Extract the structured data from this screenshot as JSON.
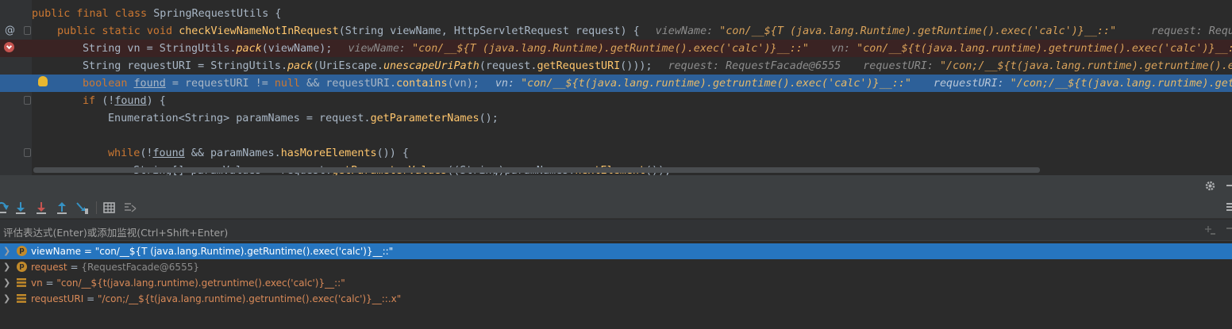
{
  "editor": {
    "lines": {
      "l1": {
        "kw": "public final class ",
        "cls": "SpringRequestUtils",
        "rest": " {"
      },
      "l2": {
        "kw": "public static void ",
        "fn": "checkViewNameNotInRequest",
        "p1": "(",
        "t1": "String",
        "a1": " viewName, ",
        "t2": "HttpServletRequest",
        "a2": " request) {",
        "h1n": "viewName: ",
        "h1v": "\"con/__${T (java.lang.Runtime).getRuntime().exec('calc')}__::\"",
        "h2n": "request: Request"
      },
      "l3": {
        "t": "String",
        "a": " vn = ",
        "c": "StringUtils",
        "d": ".",
        "m": "pack",
        "e": "(viewName);",
        "h1n": "viewName: ",
        "h1v": "\"con/__${T (java.lang.Runtime).getRuntime().exec('calc')}__::\"",
        "h2n": "vn: ",
        "h2v": "\"con/__${t(java.lang.runtime).getruntime().exec('calc')}__::"
      },
      "l4": {
        "t": "String",
        "a": " requestURI = ",
        "c": "StringUtils",
        "d": ".",
        "m": "pack",
        "p": "(",
        "c2": "UriEscape",
        "d2": ".",
        "m2": "unescapeUriPath",
        "p2": "(request.",
        "m3": "getRequestURI",
        "e": "()));",
        "h1n": "request: ",
        "h1v": "RequestFacade@6555",
        "h2n": "requestURI: ",
        "h2v": "\"/con;/__${t(java.lang.runtime).getruntime().ex"
      },
      "l5": {
        "kw": "boolean ",
        "v": "found",
        "a": " = requestURI != ",
        "kw2": "null",
        "b": " && requestURI.",
        "m": "contains",
        "e": "(vn);",
        "h1n": "vn: ",
        "h1v": "\"con/__${t(java.lang.runtime).getruntime().exec('calc')}__::\"",
        "h2n": "requestURI: ",
        "h2v": "\"/con;/__${t(java.lang.runtime).getr"
      },
      "l6": {
        "kw": "if ",
        "a": "(!",
        "v": "found",
        "e": ") {"
      },
      "l7": {
        "t": "Enumeration",
        "g": "<String>",
        "a": " paramNames = request.",
        "m": "getParameterNames",
        "e": "();"
      },
      "l8": {
        "kw": "while",
        "a": "(!",
        "v": "found",
        "b": " && paramNames.",
        "m": "hasMoreElements",
        "e": "()) {"
      },
      "l9": {
        "t": "String[]",
        "a": " paramValues = request.",
        "m": "getParameterValues",
        "p": "((",
        "t2": "String",
        "b": ")paramNames.",
        "m2": "nextElement",
        "e": "());"
      }
    },
    "gutter": {
      "at": "@"
    }
  },
  "eval": {
    "placeholder": "评估表达式(Enter)或添加监视(Ctrl+Shift+Enter)"
  },
  "variables": [
    {
      "icon": "p",
      "name": "viewName",
      "eq": " = ",
      "value": "\"con/__${T (java.lang.Runtime).getRuntime().exec('calc')}__::\"",
      "selected": true
    },
    {
      "icon": "p",
      "name": "request",
      "eq": " = ",
      "value": "{RequestFacade@6555}"
    },
    {
      "icon": "list",
      "name": "vn",
      "eq": " = ",
      "value": "\"con/__${t(java.lang.runtime).getruntime().exec('calc')}__::\""
    },
    {
      "icon": "list",
      "name": "requestURI",
      "eq": " = ",
      "value": "\"/con;/__${t(java.lang.runtime).getruntime().exec('calc')}__::.x\""
    }
  ],
  "colors": {
    "selection": "#2675bf",
    "currentLine": "#2d6099",
    "keyword": "#cc7832",
    "method": "#ffc66d"
  }
}
